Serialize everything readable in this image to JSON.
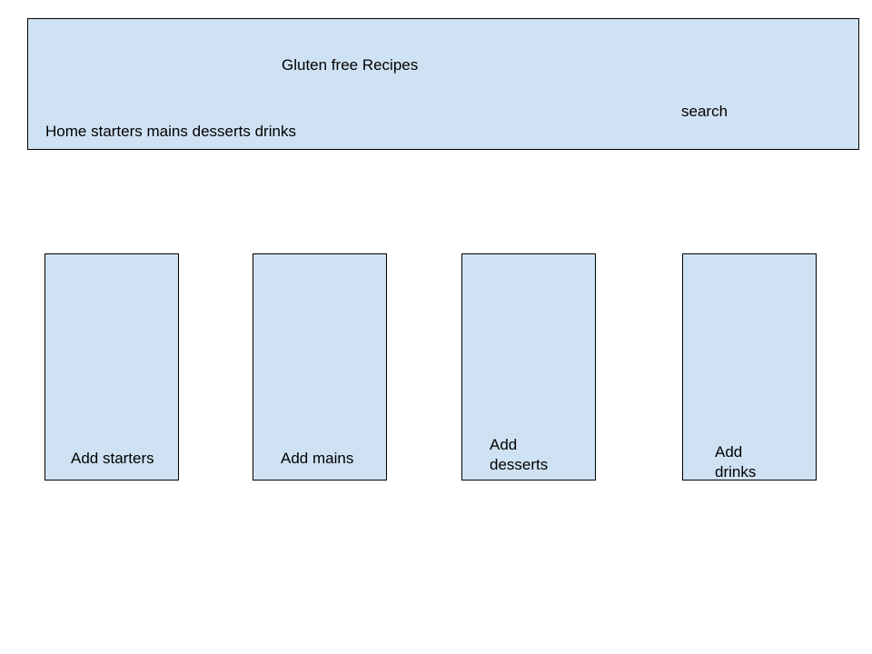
{
  "header": {
    "title": "Gluten free Recipes",
    "search_label": "search",
    "nav": {
      "home": "Home",
      "starters": "starters",
      "mains": "mains",
      "desserts": "desserts",
      "drinks": "drinks"
    }
  },
  "cards": {
    "starters": "Add starters",
    "mains": "Add mains",
    "desserts_line1": "Add",
    "desserts_line2": "desserts",
    "drinks_line1": "Add",
    "drinks_line2": "drinks"
  },
  "colors": {
    "panel_fill": "#cfe2f3",
    "border": "#000000",
    "background": "#ffffff"
  }
}
